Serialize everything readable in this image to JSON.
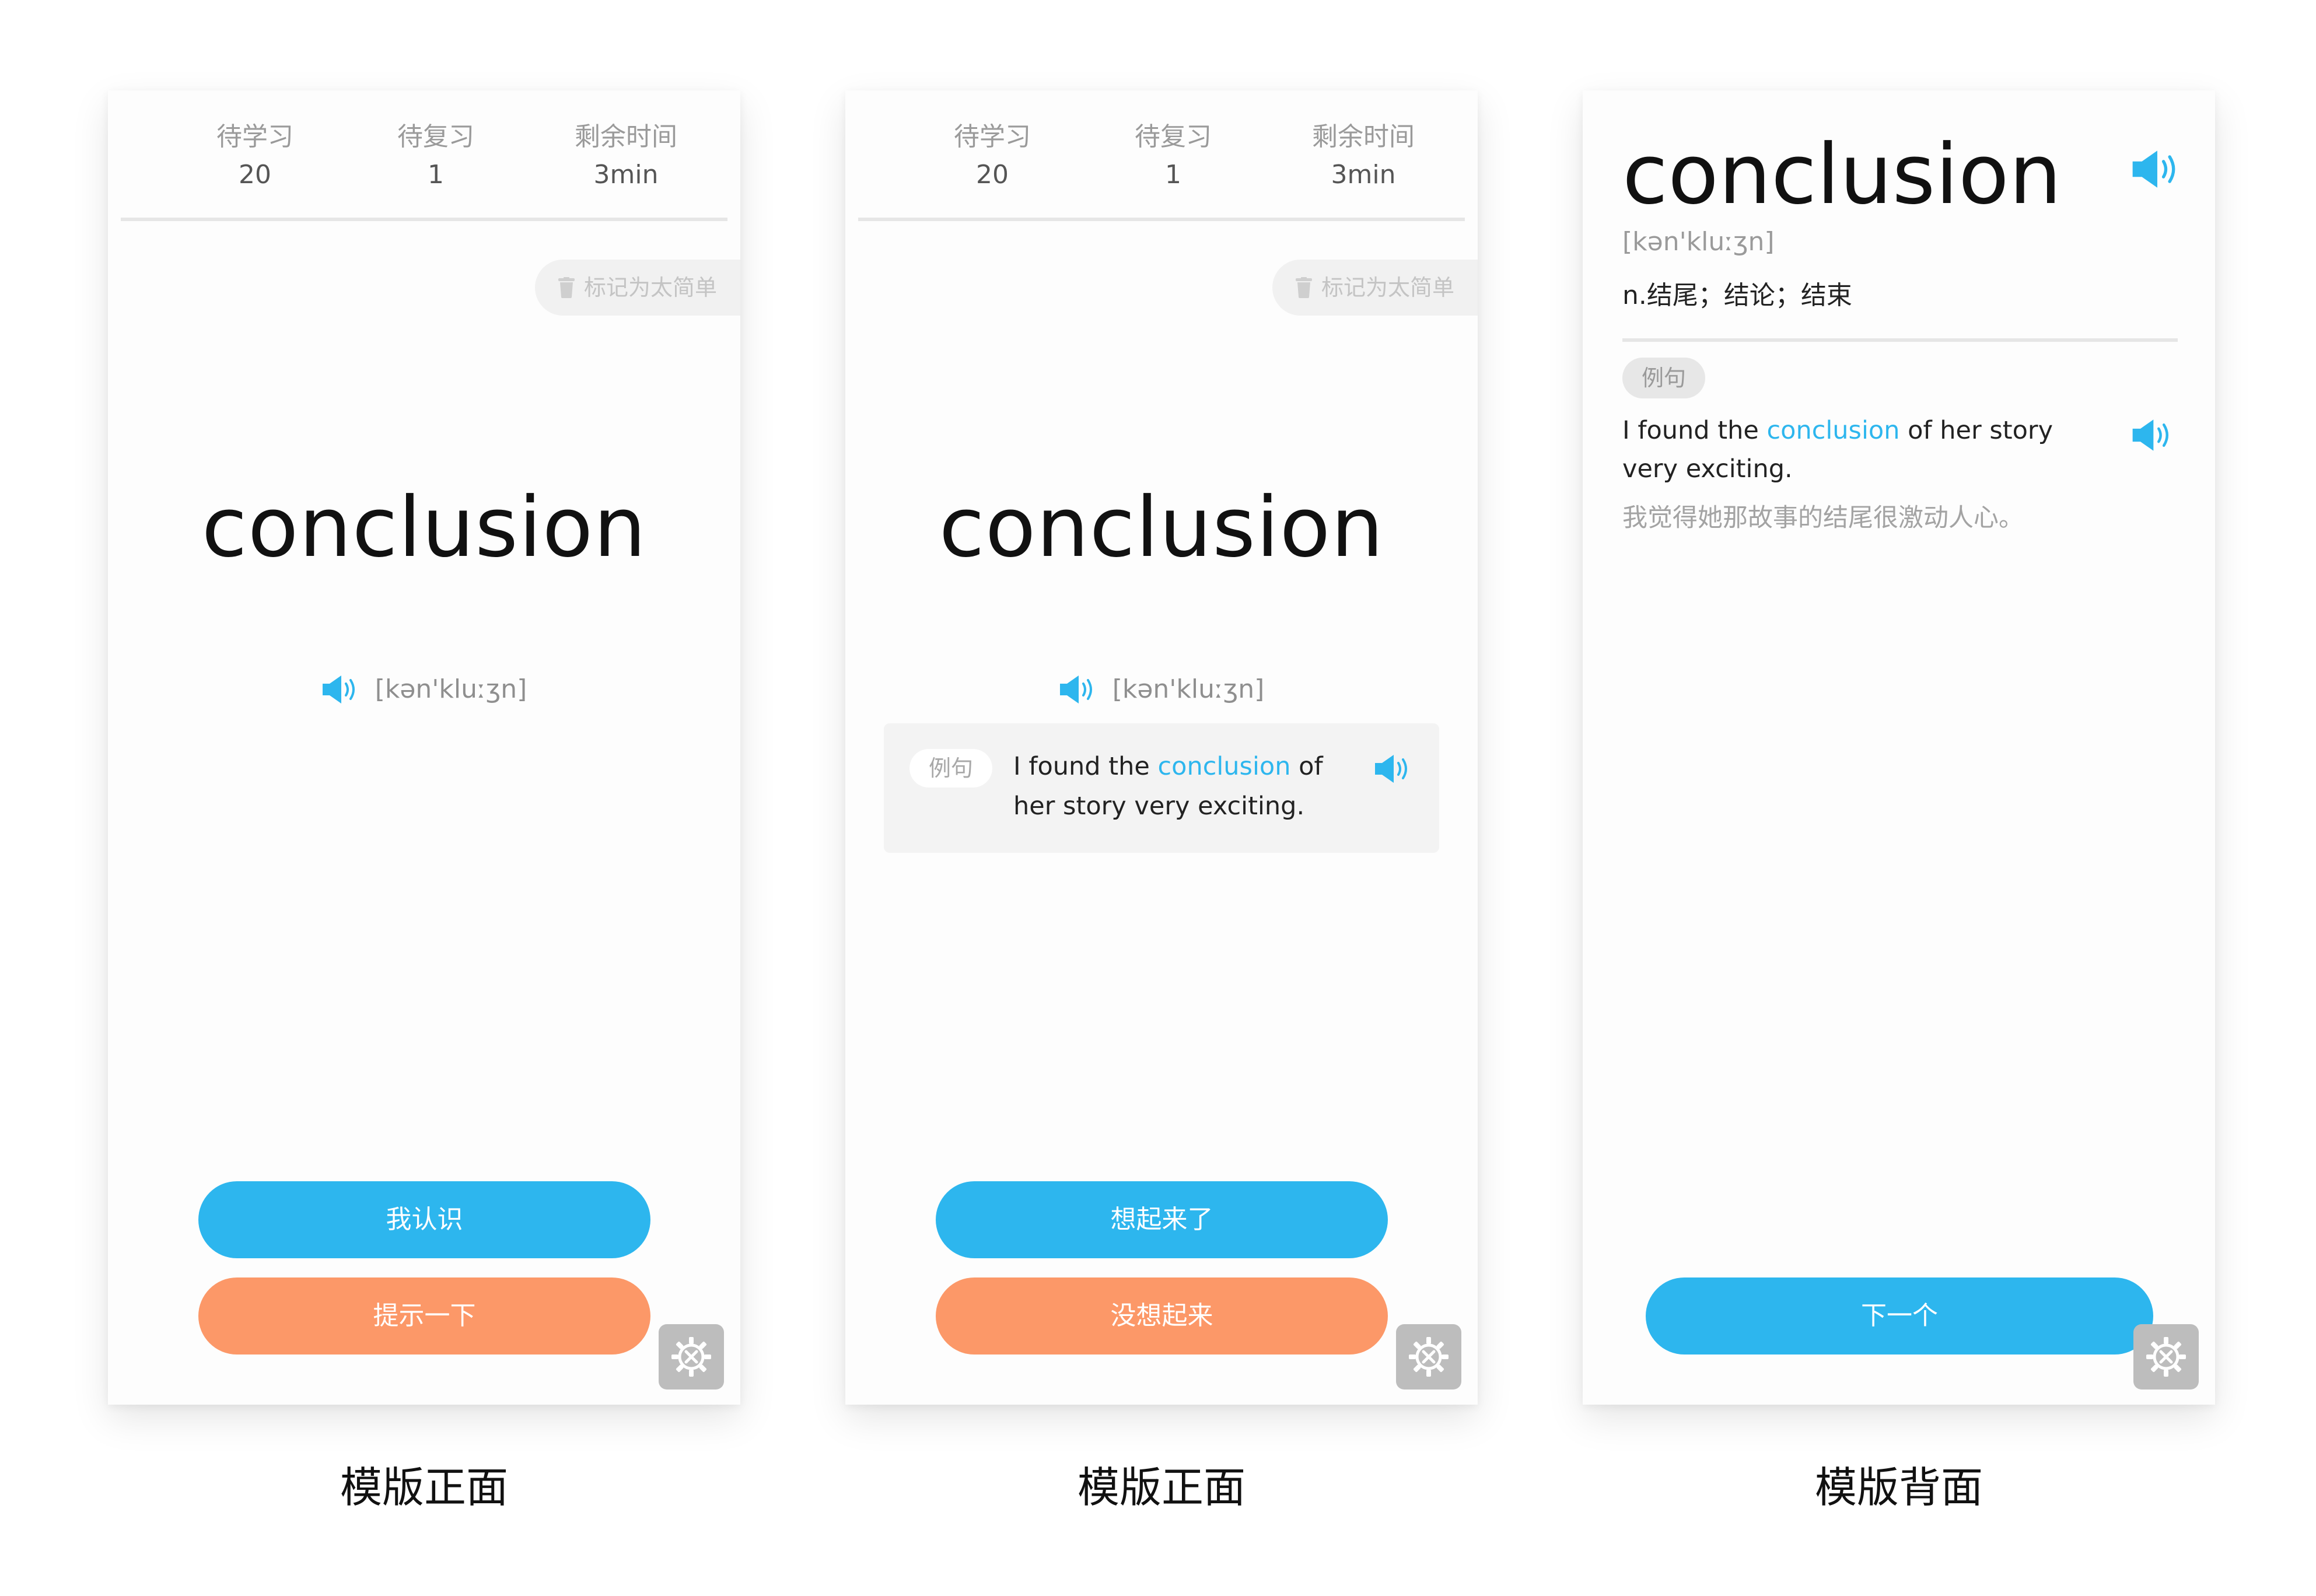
{
  "stats": [
    {
      "label": "待学习",
      "value": "20"
    },
    {
      "label": "待复习",
      "value": "1"
    },
    {
      "label": "剩余时间",
      "value": "3min"
    }
  ],
  "mark_easy_label": "标记为太简单",
  "word": "conclusion",
  "phonetic": "[kən'kluːʒn]",
  "definition": "n.结尾；结论；结束",
  "example_tag": "例句",
  "example": {
    "before": "I found the ",
    "highlight": "conclusion",
    "after_front": " of her story very exciting.",
    "after_back": " of her story very exciting."
  },
  "translation": "我觉得她那故事的结尾很激动人心。",
  "front1": {
    "known_button": "我认识",
    "hint_button": "提示一下"
  },
  "front2": {
    "remembered_button": "想起来了",
    "forgot_button": "没想起来"
  },
  "back": {
    "next_button": "下一个"
  },
  "captions": [
    "模版正面",
    "模版正面",
    "模版背面"
  ],
  "colors": {
    "accent_blue": "#2db6ee",
    "accent_orange": "#fc9868",
    "card_bg": "#fdfdfd",
    "gear_bg": "#bdbdbd"
  },
  "icons": {
    "speaker": "speaker-icon",
    "trash": "trash-icon",
    "settings": "gear-icon"
  }
}
